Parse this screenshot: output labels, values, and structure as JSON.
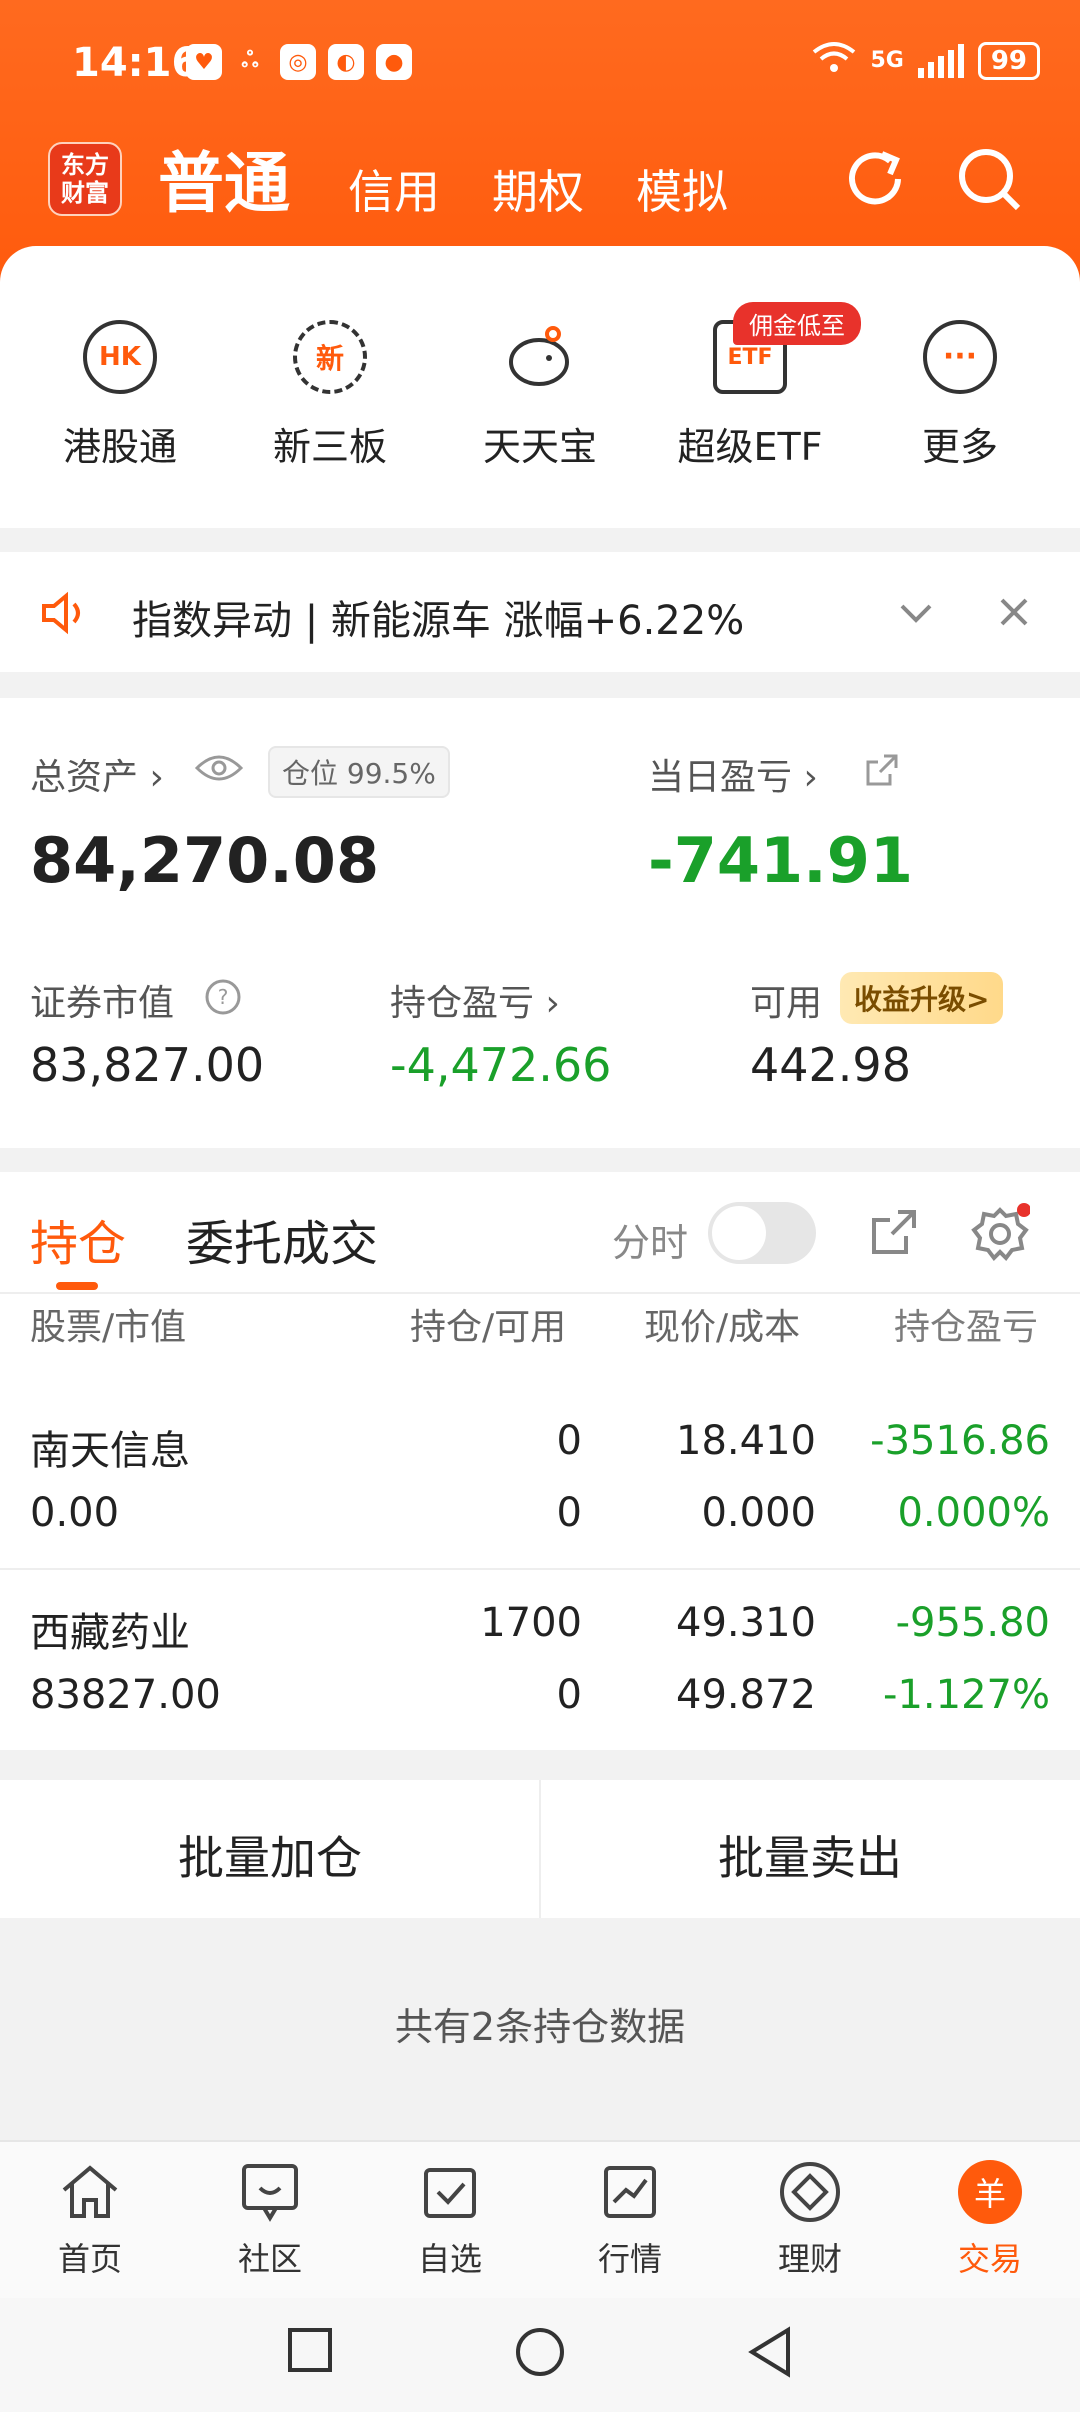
{
  "status_bar": {
    "time": "14:16",
    "network": "5G",
    "battery": "99"
  },
  "header": {
    "logo": "东方财富",
    "tabs": [
      "普通",
      "信用",
      "期权",
      "模拟"
    ]
  },
  "quick_actions": [
    {
      "label": "港股通",
      "icon_text": "HK"
    },
    {
      "label": "新三板",
      "icon_text": "新"
    },
    {
      "label": "天天宝",
      "icon_text": ""
    },
    {
      "label": "超级ETF",
      "icon_text": "ETF",
      "badge": "佣金低至"
    },
    {
      "label": "更多",
      "icon_text": "···"
    }
  ],
  "notice": {
    "text": "指数异动 | 新能源车 涨幅+6.22%"
  },
  "assets": {
    "total_label": "总资产",
    "position_pill": "仓位 99.5%",
    "total_value": "84,270.08",
    "daily_label": "当日盈亏",
    "daily_value": "-741.91",
    "market_label": "证券市值",
    "market_value": "83,827.00",
    "hold_pl_label": "持仓盈亏",
    "hold_pl_value": "-4,472.66",
    "available_label": "可用",
    "available_badge": "收益升级>",
    "available_value": "442.98"
  },
  "holdings": {
    "tabs": [
      "持仓",
      "委托成交"
    ],
    "toggle_label": "分时",
    "columns": [
      "股票/市值",
      "持仓/可用",
      "现价/成本",
      "持仓盈亏"
    ],
    "rows": [
      {
        "name": "南天信息",
        "value": "0.00",
        "hold": "0",
        "avail": "0",
        "price": "18.410",
        "cost": "0.000",
        "pl": "-3516.86",
        "pl_pct": "0.000%"
      },
      {
        "name": "西藏药业",
        "value": "83827.00",
        "hold": "1700",
        "avail": "0",
        "price": "49.310",
        "cost": "49.872",
        "pl": "-955.80",
        "pl_pct": "-1.127%"
      }
    ]
  },
  "batch": {
    "add": "批量加仓",
    "sell": "批量卖出"
  },
  "summary": "共有2条持仓数据",
  "bottom_nav": [
    {
      "label": "首页"
    },
    {
      "label": "社区"
    },
    {
      "label": "自选"
    },
    {
      "label": "行情"
    },
    {
      "label": "理财"
    },
    {
      "label": "交易",
      "icon_text": "羊"
    }
  ],
  "colors": {
    "brand": "#ff5a0c",
    "up": "#e8322b",
    "down": "#1aa02a"
  }
}
